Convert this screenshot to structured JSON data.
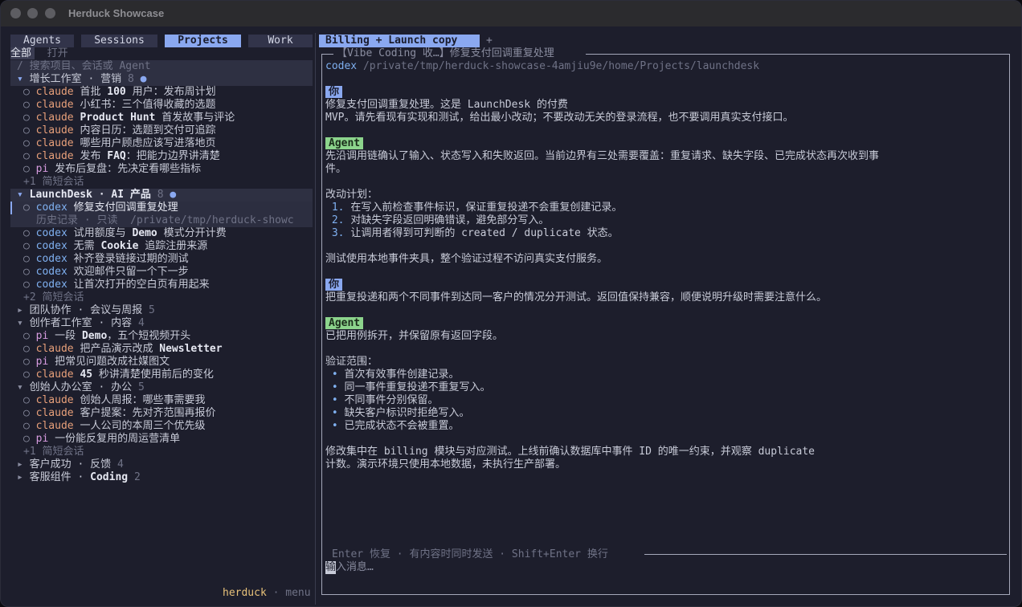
{
  "window": {
    "title": "Herduck Showcase"
  },
  "sidebar": {
    "tabs": [
      {
        "label": "Agents",
        "active": false
      },
      {
        "label": "Sessions",
        "active": false
      },
      {
        "label": "Projects",
        "active": true
      },
      {
        "label": "Work",
        "active": false
      }
    ],
    "filter": {
      "all": "全部",
      "open": "打开"
    },
    "search_placeholder": "/ 搜索项目、会话或 Agent",
    "groups": {
      "growth": {
        "title": "增长工作室 · 营销",
        "count": "8",
        "dot": "●",
        "items": [
          {
            "agent": "claude",
            "pre": "首批 ",
            "bold": "100",
            "post": " 用户：发布周计划"
          },
          {
            "agent": "claude",
            "pre": "小红书：三个值得收藏的选题",
            "bold": "",
            "post": ""
          },
          {
            "agent": "claude",
            "pre": "",
            "bold": "Product Hunt",
            "post": " 首发故事与评论"
          },
          {
            "agent": "claude",
            "pre": "内容日历：选题到交付可追踪",
            "bold": "",
            "post": ""
          },
          {
            "agent": "claude",
            "pre": "哪些用户顾虑应该写进落地页",
            "bold": "",
            "post": ""
          },
          {
            "agent": "claude",
            "pre": "发布 ",
            "bold": "FAQ",
            "post": "：把能力边界讲清楚"
          },
          {
            "agent": "pi",
            "pre": "发布后复盘：先决定看哪些指标",
            "bold": "",
            "post": ""
          }
        ],
        "more": "+1 简短会话"
      },
      "launchdesk": {
        "title": "LaunchDesk · AI 产品",
        "count": "8",
        "dot": "●",
        "selected": {
          "agent": "codex",
          "title": "修复支付回调重复处理",
          "sub": "历史记录 · 只读  /private/tmp/herduck-showc"
        },
        "items": [
          {
            "agent": "codex",
            "pre": "试用额度与 ",
            "bold": "Demo",
            "post": " 模式分开计费"
          },
          {
            "agent": "codex",
            "pre": "无需 ",
            "bold": "Cookie",
            "post": " 追踪注册来源"
          },
          {
            "agent": "codex",
            "pre": "补齐登录链接过期的测试",
            "bold": "",
            "post": ""
          },
          {
            "agent": "codex",
            "pre": "欢迎邮件只留一个下一步",
            "bold": "",
            "post": ""
          },
          {
            "agent": "codex",
            "pre": "让首次打开的空白页有用起来",
            "bold": "",
            "post": ""
          }
        ],
        "more": "+2 简短会话"
      },
      "team": {
        "title": "团队协作 · 会议与周报",
        "count": "5"
      },
      "creator": {
        "title": "创作者工作室 · 内容",
        "count": "4",
        "items": [
          {
            "agent": "pi",
            "pre": "一段 ",
            "bold": "Demo",
            "post": "，五个短视频开头"
          },
          {
            "agent": "claude",
            "pre": "把产品演示改成 ",
            "bold": "Newsletter",
            "post": ""
          },
          {
            "agent": "pi",
            "pre": "把常见问题改成社媒图文",
            "bold": "",
            "post": ""
          },
          {
            "agent": "claude",
            "pre": "",
            "bold": "45",
            "post": " 秒讲清楚使用前后的变化"
          }
        ]
      },
      "founder": {
        "title": "创始人办公室 · 办公",
        "count": "5",
        "items": [
          {
            "agent": "claude",
            "pre": "创始人周报：哪些事需要我",
            "bold": "",
            "post": ""
          },
          {
            "agent": "claude",
            "pre": "客户提案：先对齐范围再报价",
            "bold": "",
            "post": ""
          },
          {
            "agent": "claude",
            "pre": "一人公司的本周三个优先级",
            "bold": "",
            "post": ""
          },
          {
            "agent": "pi",
            "pre": "一份能反复用的周运营清单",
            "bold": "",
            "post": ""
          }
        ],
        "more": "+1 简短会话"
      },
      "customer": {
        "title": "客户成功 · 反馈",
        "count": "4"
      },
      "support": {
        "title_pre": "客服组件 · ",
        "title_bold": "Coding",
        "count": "2"
      }
    },
    "footer": {
      "brand": "herduck",
      "sep": "·",
      "menu": "menu"
    }
  },
  "chat": {
    "tab": {
      "label": "Billing + Launch copy",
      "add": "+"
    },
    "panel_title": "【Vibe Coding 收…】修复支付回调重复处理",
    "path_cmd": "codex",
    "path": "/private/tmp/herduck-showcase-4amjiu9e/home/Projects/launchdesk",
    "you_label": "你",
    "agent_label": "Agent",
    "msg1": [
      "修复支付回调重复处理。这是 LaunchDesk 的付费",
      "MVP。请先看现有实现和测试，给出最小改动；不要改动无关的登录流程，也不要调用真实支付接口。"
    ],
    "reply1": {
      "intro": [
        "先沿调用链确认了输入、状态写入和失败返回。当前边界有三处需要覆盖：重复请求、缺失字段、已完成状态再次收到事",
        "件。"
      ],
      "plan_title": "改动计划：",
      "plan": [
        {
          "n": "1.",
          "text": "在写入前检查事件标识，保证重复投递不会重复创建记录。"
        },
        {
          "n": "2.",
          "text": "对缺失字段返回明确错误，避免部分写入。"
        },
        {
          "n": "3.",
          "text": "让调用者得到可判断的 created / duplicate 状态。"
        }
      ],
      "outro": "测试使用本地事件夹具，整个验证过程不访问真实支付服务。"
    },
    "msg2": "把重复投递和两个不同事件到达同一客户的情况分开测试。返回值保持兼容，顺便说明升级时需要注意什么。",
    "reply2": {
      "intro": "已把用例拆开，并保留原有返回字段。",
      "scope_title": "验证范围：",
      "bullets": [
        "首次有效事件创建记录。",
        "同一事件重复投递不重复写入。",
        "不同事件分别保留。",
        "缺失客户标识时拒绝写入。",
        "已完成状态不会被重置。"
      ],
      "summary": [
        "修改集中在 billing 模块与对应测试。上线前确认数据库中事件 ID 的唯一约束，并观察 duplicate",
        "计数。演示环境只使用本地数据，未执行生产部署。"
      ]
    },
    "input": {
      "hint": "Enter 恢复 · 有内容时同时发送 · Shift+Enter 换行",
      "cursor_char": "输",
      "placeholder": "入消息…"
    }
  }
}
